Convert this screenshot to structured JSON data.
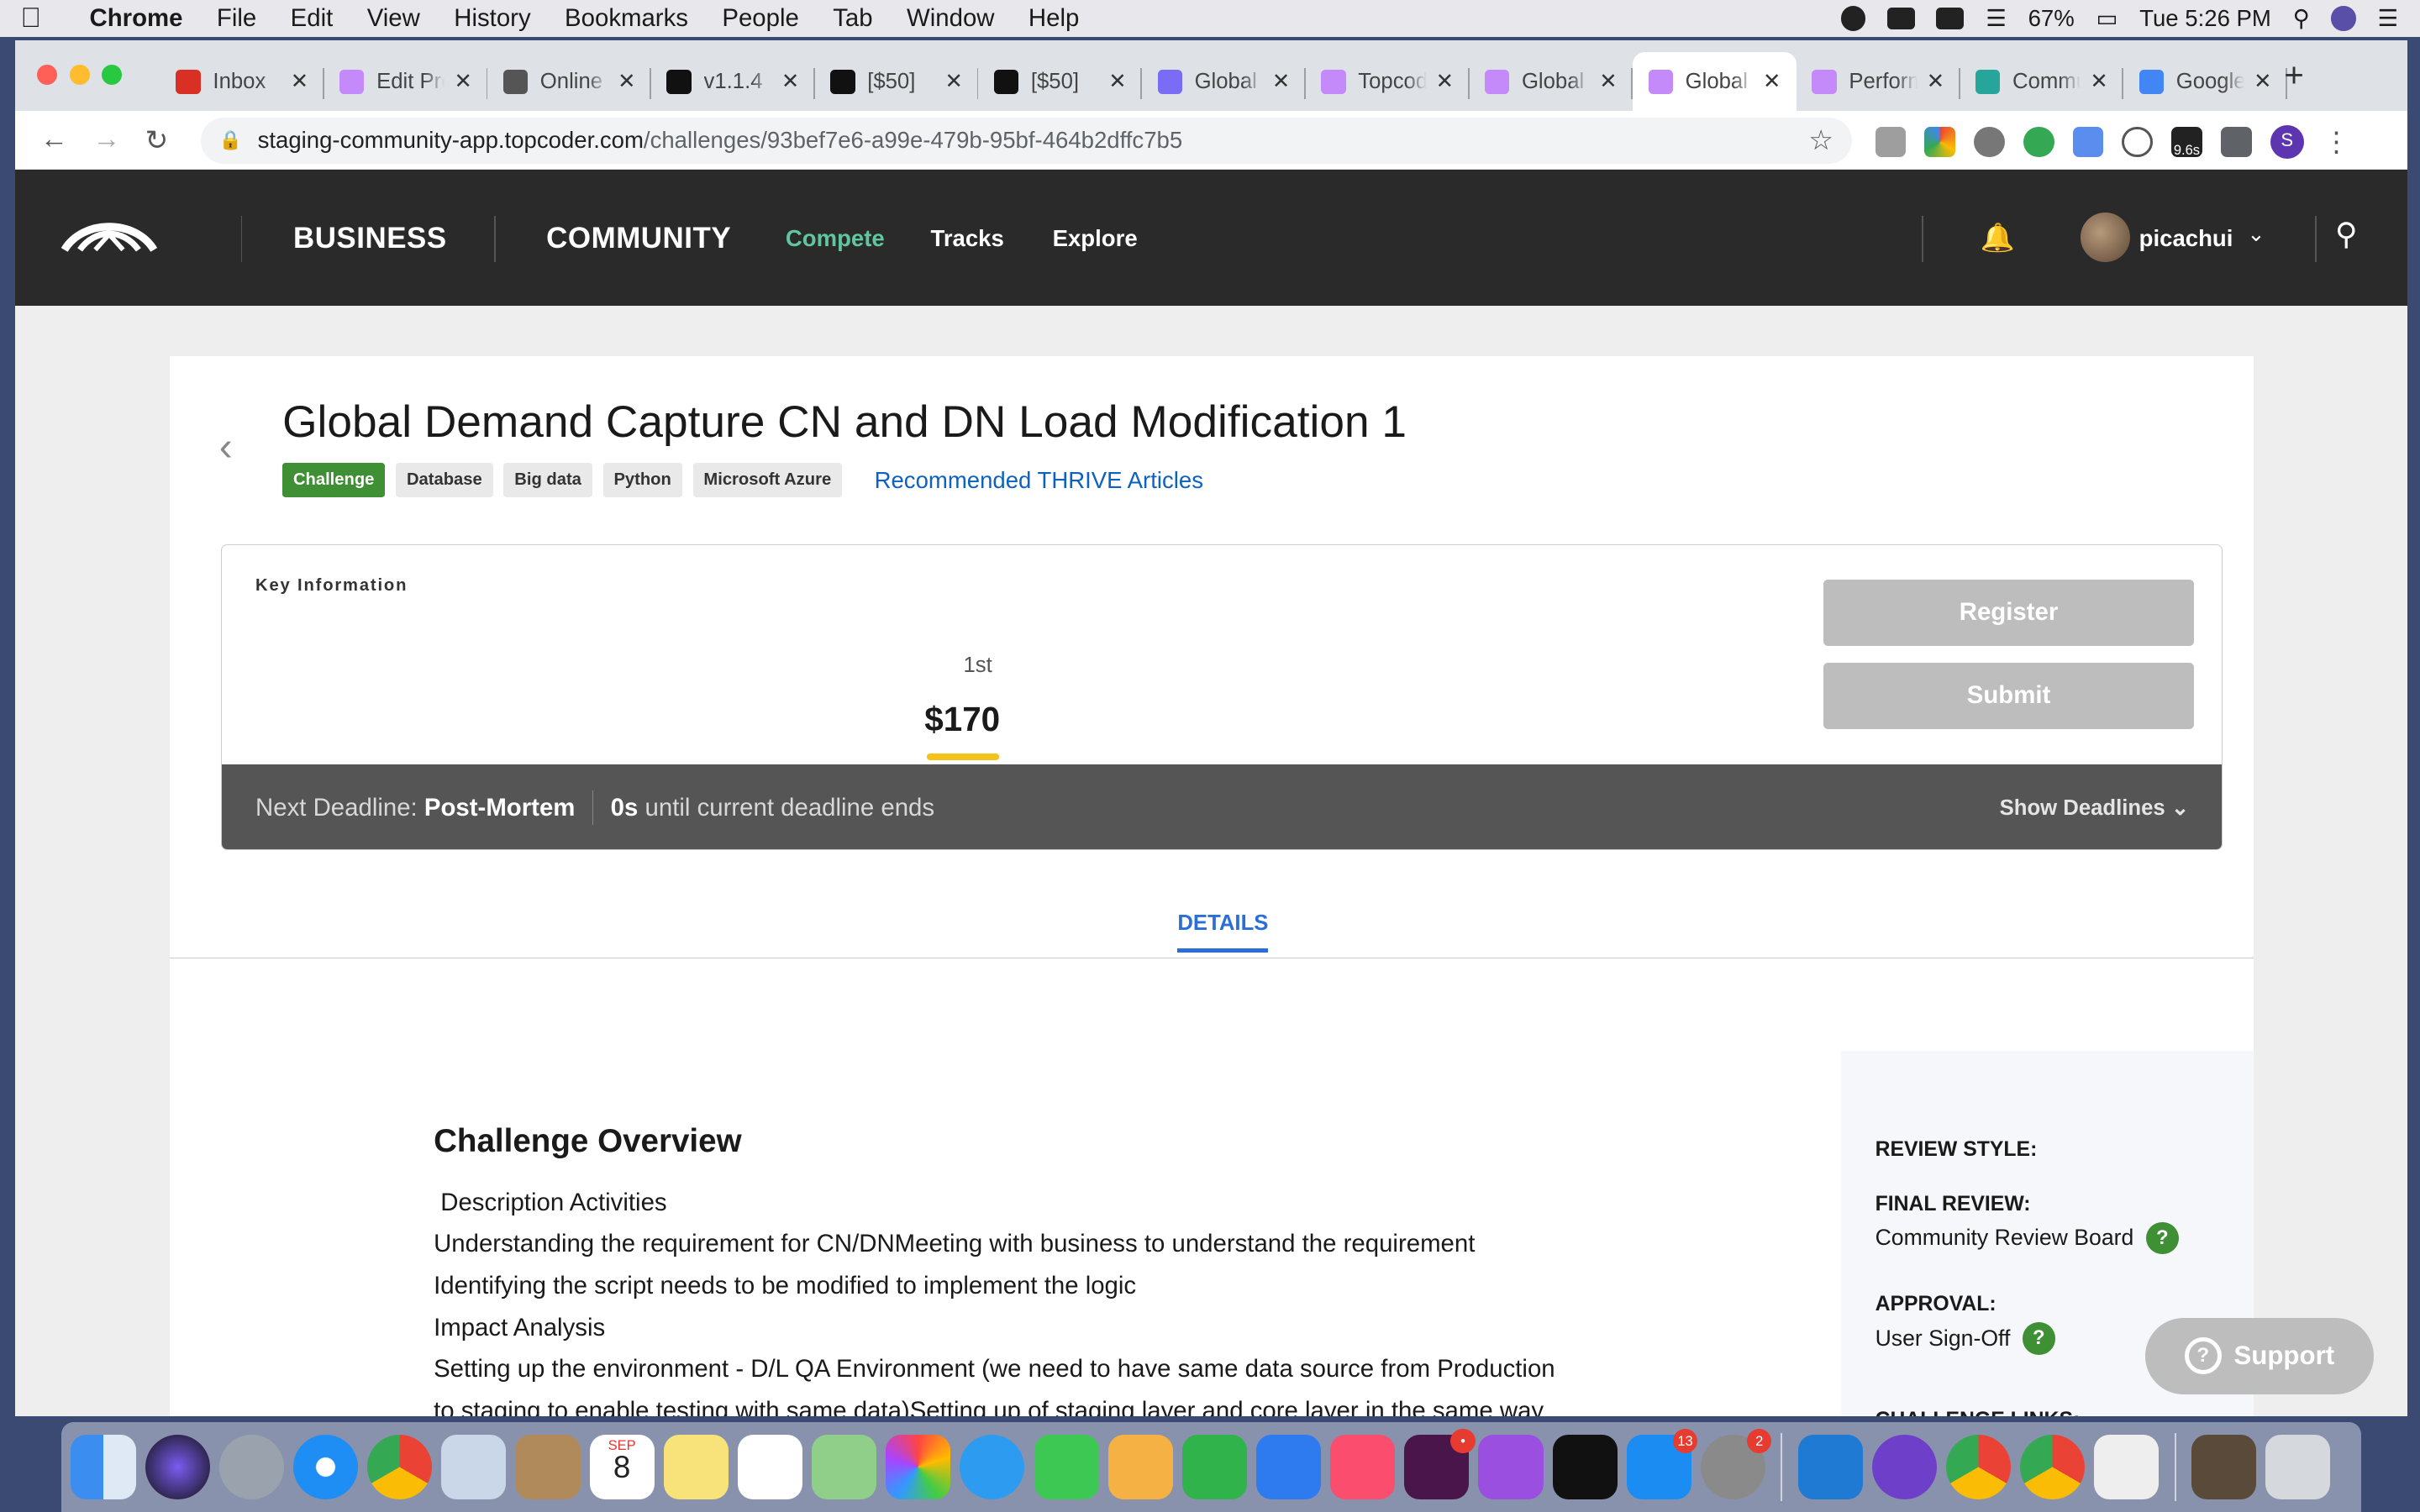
{
  "menubar": {
    "app": "Chrome",
    "items": [
      "File",
      "Edit",
      "View",
      "History",
      "Bookmarks",
      "People",
      "Tab",
      "Window",
      "Help"
    ],
    "battery": "67%",
    "clock": "Tue 5:26 PM"
  },
  "tabs": [
    {
      "title": "Inbox",
      "color": "#d93025"
    },
    {
      "title": "Edit Project",
      "color": "#c58af9"
    },
    {
      "title": "Online",
      "color": "#555"
    },
    {
      "title": "v1.1.4",
      "color": "#111"
    },
    {
      "title": "[$50]",
      "color": "#111"
    },
    {
      "title": "[$50]",
      "color": "#111"
    },
    {
      "title": "Global",
      "color": "#7b6cf6"
    },
    {
      "title": "Topcoder",
      "color": "#c58af9"
    },
    {
      "title": "Global",
      "color": "#c58af9"
    },
    {
      "title": "Global",
      "color": "#c58af9",
      "active": true
    },
    {
      "title": "Performance",
      "color": "#c58af9"
    },
    {
      "title": "Community",
      "color": "#26a69a"
    },
    {
      "title": "Google",
      "color": "#4285f4"
    }
  ],
  "address": {
    "host": "staging-community-app.topcoder.com",
    "path": "/challenges/93bef7e6-a99e-479b-95bf-464b2dffc7b5"
  },
  "ext_timer": "9.6s",
  "profile_initial": "S",
  "header": {
    "business": "BUSINESS",
    "community": "COMMUNITY",
    "compete": "Compete",
    "tracks": "Tracks",
    "explore": "Explore",
    "username": "picachui",
    "accent": "#60c5a0"
  },
  "challenge": {
    "title": "Global Demand Capture CN and DN Load Modification 1",
    "tags": [
      "Challenge",
      "Database",
      "Big data",
      "Python",
      "Microsoft Azure"
    ],
    "thrive": "Recommended THRIVE Articles",
    "key_info": "Key Information",
    "place": "1st",
    "prize": "$170",
    "register": "Register",
    "submit": "Submit",
    "deadline_label": "Next Deadline:",
    "deadline_phase": "Post-Mortem",
    "deadline_time": "0s",
    "deadline_suffix": "until current deadline ends",
    "show_deadlines": "Show Deadlines",
    "details_tab": "DETAILS"
  },
  "overview": {
    "heading": "Challenge Overview",
    "lines": [
      " Description Activities",
      "Understanding the requirement for CN/DNMeeting with business to understand the requirement",
      "Identifying the script needs to be modified to implement the logic",
      "Impact Analysis",
      "Setting up the environment - D/L QA Environment (we need to have same data source from Production",
      "to staging to enable testing with same data)Setting up of staging layer and core layer in the same way"
    ]
  },
  "sidebar": {
    "review_style": "REVIEW STYLE:",
    "final_review": "FINAL REVIEW:",
    "final_value": "Community Review Board",
    "approval": "APPROVAL:",
    "approval_value": "User Sign-Off",
    "links": "CHALLENGE LINKS:"
  },
  "support": "Support",
  "dock": {
    "calendar_month": "SEP",
    "calendar_day": "8",
    "badge_appstore": "13",
    "badge_prefs": "2"
  }
}
